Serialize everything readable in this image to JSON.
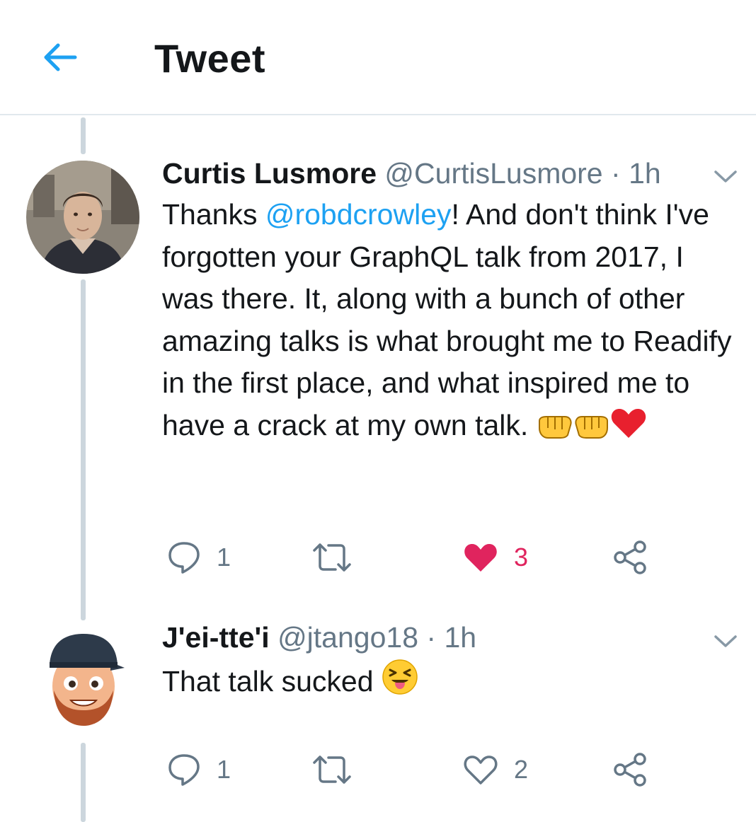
{
  "header": {
    "title": "Tweet",
    "back_icon": "arrow-left-icon",
    "accent": "#1da1f2"
  },
  "tweets": [
    {
      "name": "Curtis Lusmore",
      "handle": "@CurtisLusmore",
      "separator": "·",
      "time": "1h",
      "body": {
        "prefix": "Thanks ",
        "mention": "@robdcrowley",
        "suffix": "! And don't think I've forgotten your GraphQL talk from 2017, I was there. It, along with a bunch of other amazing talks is what brought me to Readify in the first place, and what inspired me to have a crack at my own talk. "
      },
      "emojis": [
        "left-facing-fist-emoji",
        "right-facing-fist-emoji",
        "red-heart-emoji"
      ],
      "actions": {
        "reply_count": "1",
        "retweet_count": "",
        "like_count": "3",
        "liked": true
      }
    },
    {
      "name": "J'ei-tte'i",
      "handle": "@jtango18",
      "separator": "·",
      "time": "1h",
      "body": {
        "text": "That talk sucked "
      },
      "emojis": [
        "squinting-face-with-tongue-emoji"
      ],
      "actions": {
        "reply_count": "1",
        "retweet_count": "",
        "like_count": "2",
        "liked": false
      }
    }
  ],
  "colors": {
    "text": "#14171a",
    "secondary": "#657786",
    "like": "#e0245e",
    "thread_line": "#ccd6dd"
  }
}
